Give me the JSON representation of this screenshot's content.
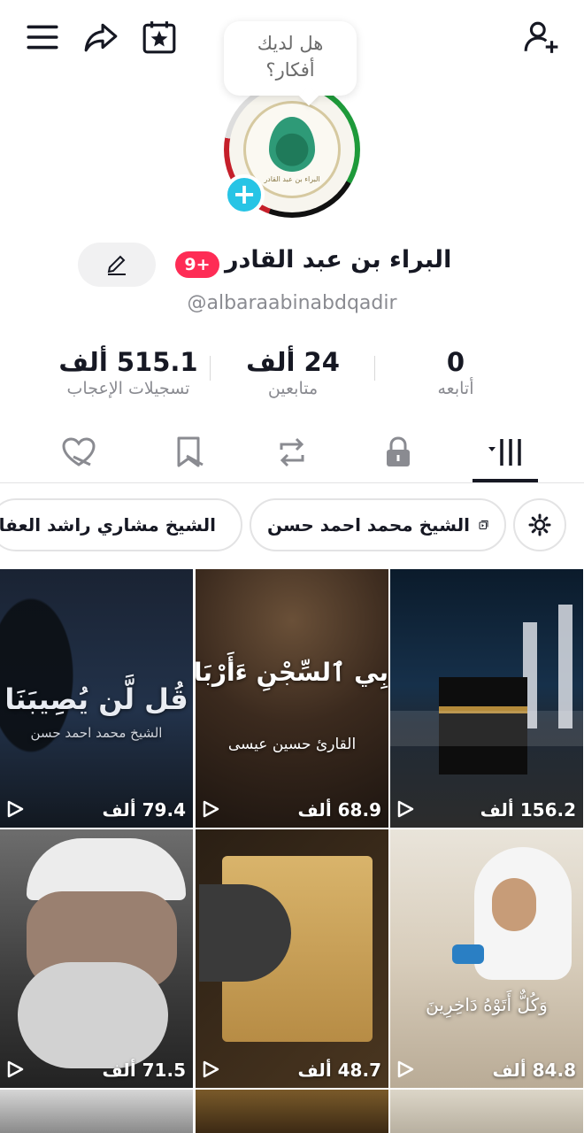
{
  "header": {
    "icons": [
      "menu-icon",
      "share-icon",
      "calendar-star-icon",
      "add-friend-icon"
    ]
  },
  "bubble": {
    "line1": "هل لديك",
    "line2": "أفكار؟"
  },
  "profile": {
    "display_name": "البراء بن عبد القادر",
    "notification_badge": "9+",
    "username": "@albaraabinabdqadir",
    "logo_caption": "البراء بن عبد القادر"
  },
  "stats": [
    {
      "value": "0",
      "label": "أتابعه"
    },
    {
      "value": "24 ألف",
      "label": "متابعين"
    },
    {
      "value": "515.1 ألف",
      "label": "تسجيلات الإعجاب"
    }
  ],
  "tabs": [
    "videos-tab",
    "private-tab",
    "reposts-tab",
    "favorites-tab",
    "liked-tab"
  ],
  "playlists": [
    {
      "label": "الشيخ محمد احمد حسن"
    },
    {
      "label": "الشيخ مشاري راشد العفاسي"
    }
  ],
  "videos": [
    {
      "views": "156.2 ألف",
      "caption": "",
      "caption2": ""
    },
    {
      "views": "68.9 ألف",
      "caption": "بِي ٱلسِّجْنِ ءَأَرْبَابٌ مُّتَفَرِّ",
      "caption2": "القارئ حسين عيسى"
    },
    {
      "views": "79.4 ألف",
      "caption": "قُل لَّن يُصِيبَنَا",
      "caption2": "الشيخ محمد احمد حسن"
    },
    {
      "views": "84.8 ألف",
      "caption": "وَكُلٌّ أَتَوْهُ دَاخِرِينَ",
      "caption2": ""
    },
    {
      "views": "48.7 ألف",
      "caption": "",
      "caption2": ""
    },
    {
      "views": "71.5 ألف",
      "caption": "",
      "caption2": ""
    }
  ],
  "colors": {
    "accent_red": "#fe2c55",
    "accent_cyan": "#27c4e5",
    "text": "#161823",
    "muted": "#8a8b91"
  }
}
